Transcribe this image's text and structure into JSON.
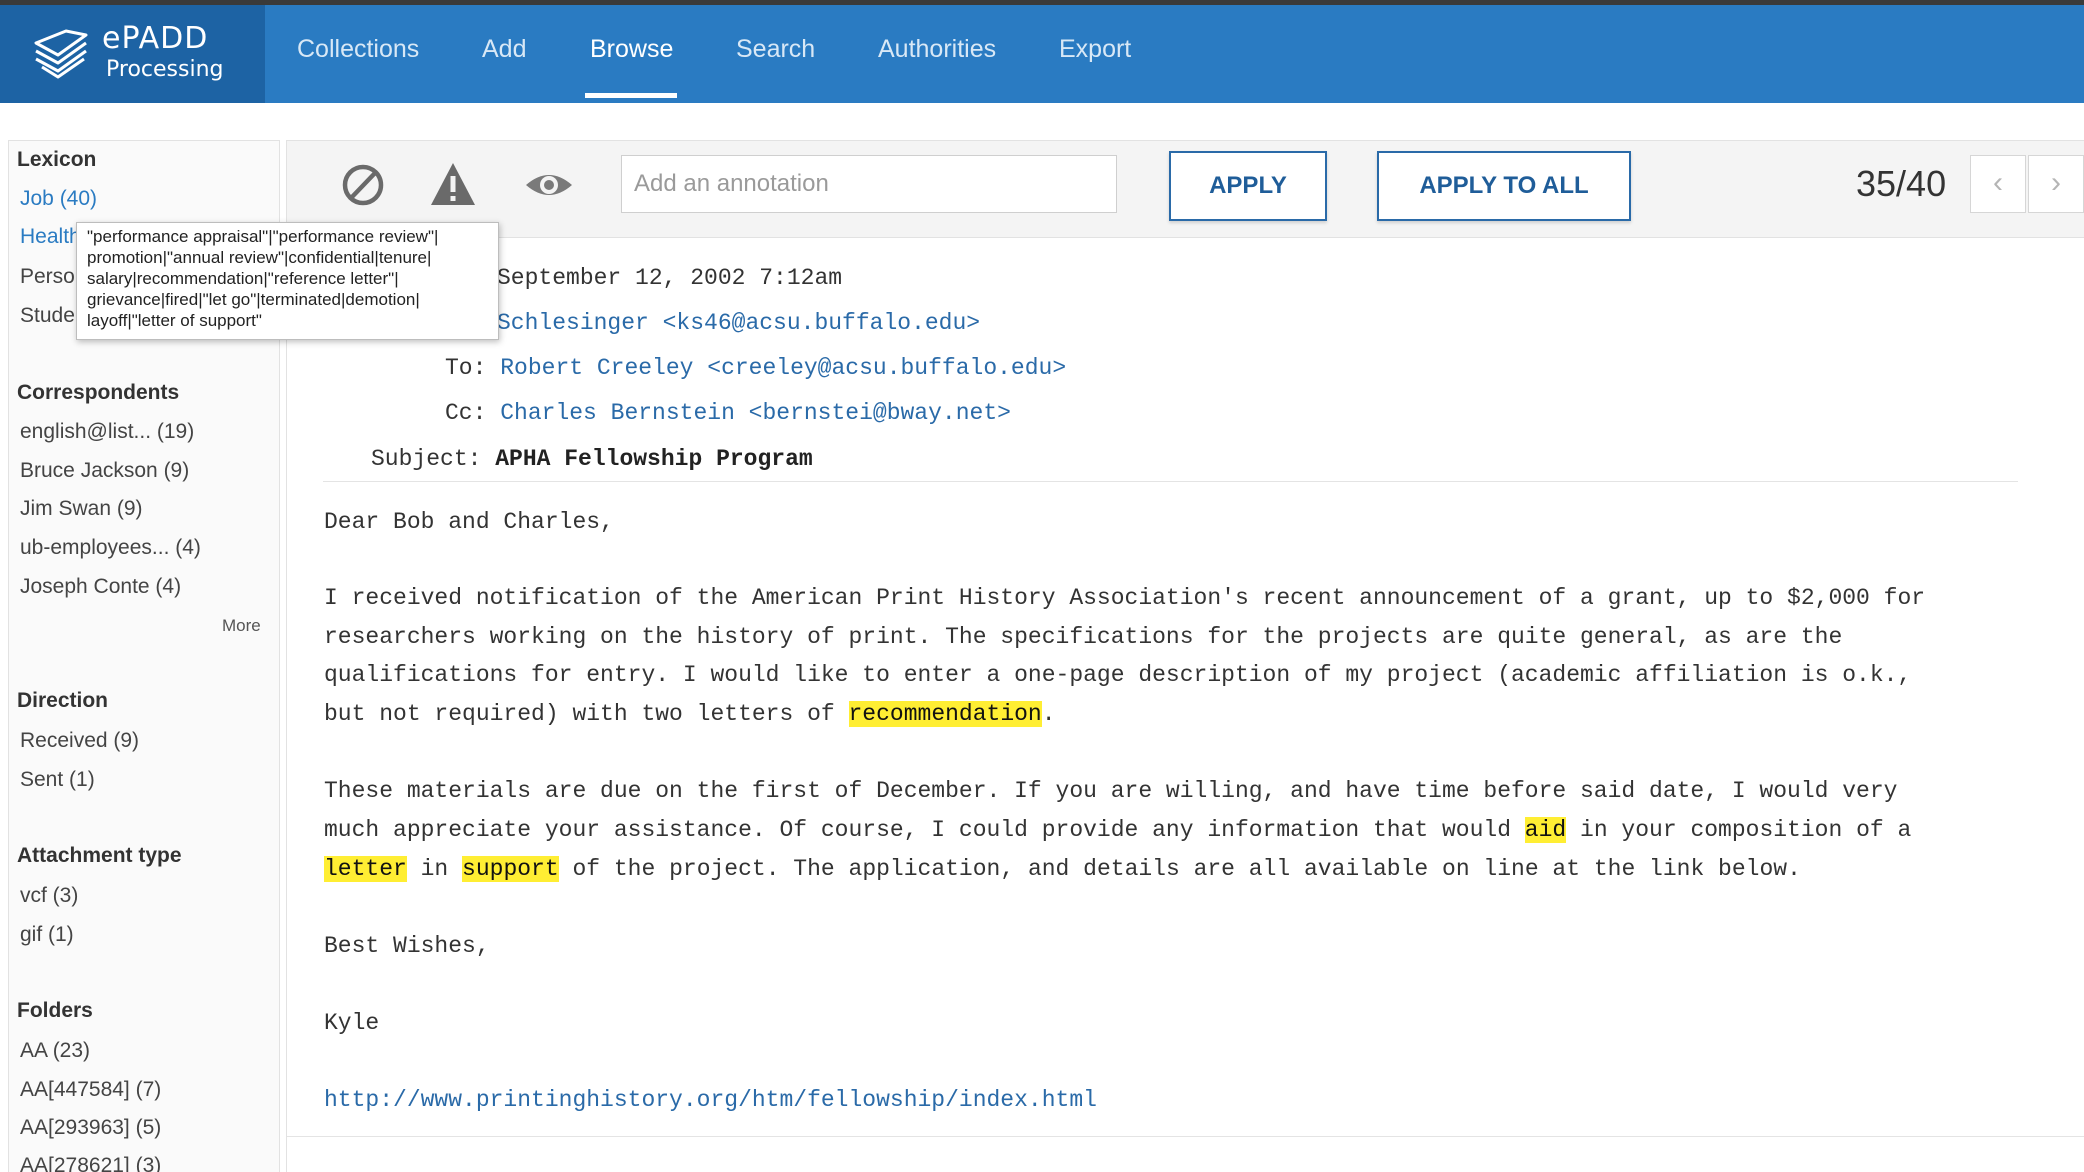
{
  "brand": {
    "title": "ePADD",
    "subtitle": "Processing"
  },
  "nav": {
    "items": [
      {
        "label": "Collections"
      },
      {
        "label": "Add"
      },
      {
        "label": "Browse"
      },
      {
        "label": "Search"
      },
      {
        "label": "Authorities"
      },
      {
        "label": "Export"
      }
    ],
    "active": "Browse"
  },
  "sidebar": {
    "lexicon": {
      "title": "Lexicon",
      "items": [
        "Job (40)",
        "Health",
        "Perso",
        "Stude"
      ]
    },
    "tooltip": {
      "lines": [
        "\"performance appraisal\"|\"performance review\"|",
        "promotion|\"annual review\"|confidential|tenure|",
        "salary|recommendation|\"reference letter\"|",
        "grievance|fired|\"let go\"|terminated|demotion|",
        "layoff|\"letter of support\""
      ]
    },
    "correspondents": {
      "title": "Correspondents",
      "items": [
        "english@list... (19)",
        "Bruce Jackson (9)",
        "Jim Swan (9)",
        "ub-employees... (4)",
        "Joseph Conte (4)"
      ],
      "more": "More"
    },
    "direction": {
      "title": "Direction",
      "items": [
        "Received (9)",
        "Sent (1)"
      ]
    },
    "attachment_type": {
      "title": "Attachment type",
      "items": [
        "vcf (3)",
        "gif (1)"
      ]
    },
    "folders": {
      "title": "Folders",
      "items": [
        "AA (23)",
        "AA[447584] (7)",
        "AA[293963] (5)",
        "AA[278621] (3)"
      ]
    }
  },
  "toolbar": {
    "icons": [
      "restrict-icon",
      "warning-icon",
      "eye-icon"
    ],
    "annotation_placeholder": "Add an annotation",
    "apply_label": "APPLY",
    "apply_all_label": "APPLY TO ALL",
    "counter": "35/40",
    "prev": "‹",
    "next": "›"
  },
  "email": {
    "date_value": "September 12, 2002 7:12am",
    "from_value": "Schlesinger <ks46@acsu.buffalo.edu>",
    "to_label": "To:",
    "to_value": "Robert Creeley <creeley@acsu.buffalo.edu>",
    "cc_label": "Cc:",
    "cc_value": "Charles Bernstein <bernstei@bway.net>",
    "subject_label": "Subject:",
    "subject_value": "APHA Fellowship Program",
    "greeting": "Dear Bob and Charles,",
    "p1_l1": "I received notification of the American Print History Association's recent announcement of a grant, up to $2,000 for",
    "p1_l2": "researchers working on the history of print. The specifications for the projects are quite general, as are the",
    "p1_l3": "qualifications for entry. I would like to enter a one-page description of my project (academic affiliation is o.k.,",
    "p1_l4_pre": "but not required) with two letters of ",
    "p1_l4_hl": "recommendation",
    "p1_l4_post": ".",
    "p2_l1": "These materials are due on the first of December. If you are willing, and have time before said date, I would very",
    "p2_l2_pre": "much appreciate your assistance. Of course, I could provide any information that would ",
    "p2_l2_hl": "aid",
    "p2_l2_post": " in your composition of a",
    "p2_l3_hl1": "letter",
    "p2_l3_mid": " in ",
    "p2_l3_hl2": "support",
    "p2_l3_post": " of the project. The application, and details are all available on line at the link below.",
    "signoff": "Best Wishes,",
    "signature": "Kyle",
    "link": "http://www.printinghistory.org/htm/fellowship/index.html"
  },
  "colors": {
    "nav": "#2a7bc2",
    "brand": "#1d63a4",
    "highlight": "#ffee33",
    "link": "#2a6aa8"
  }
}
